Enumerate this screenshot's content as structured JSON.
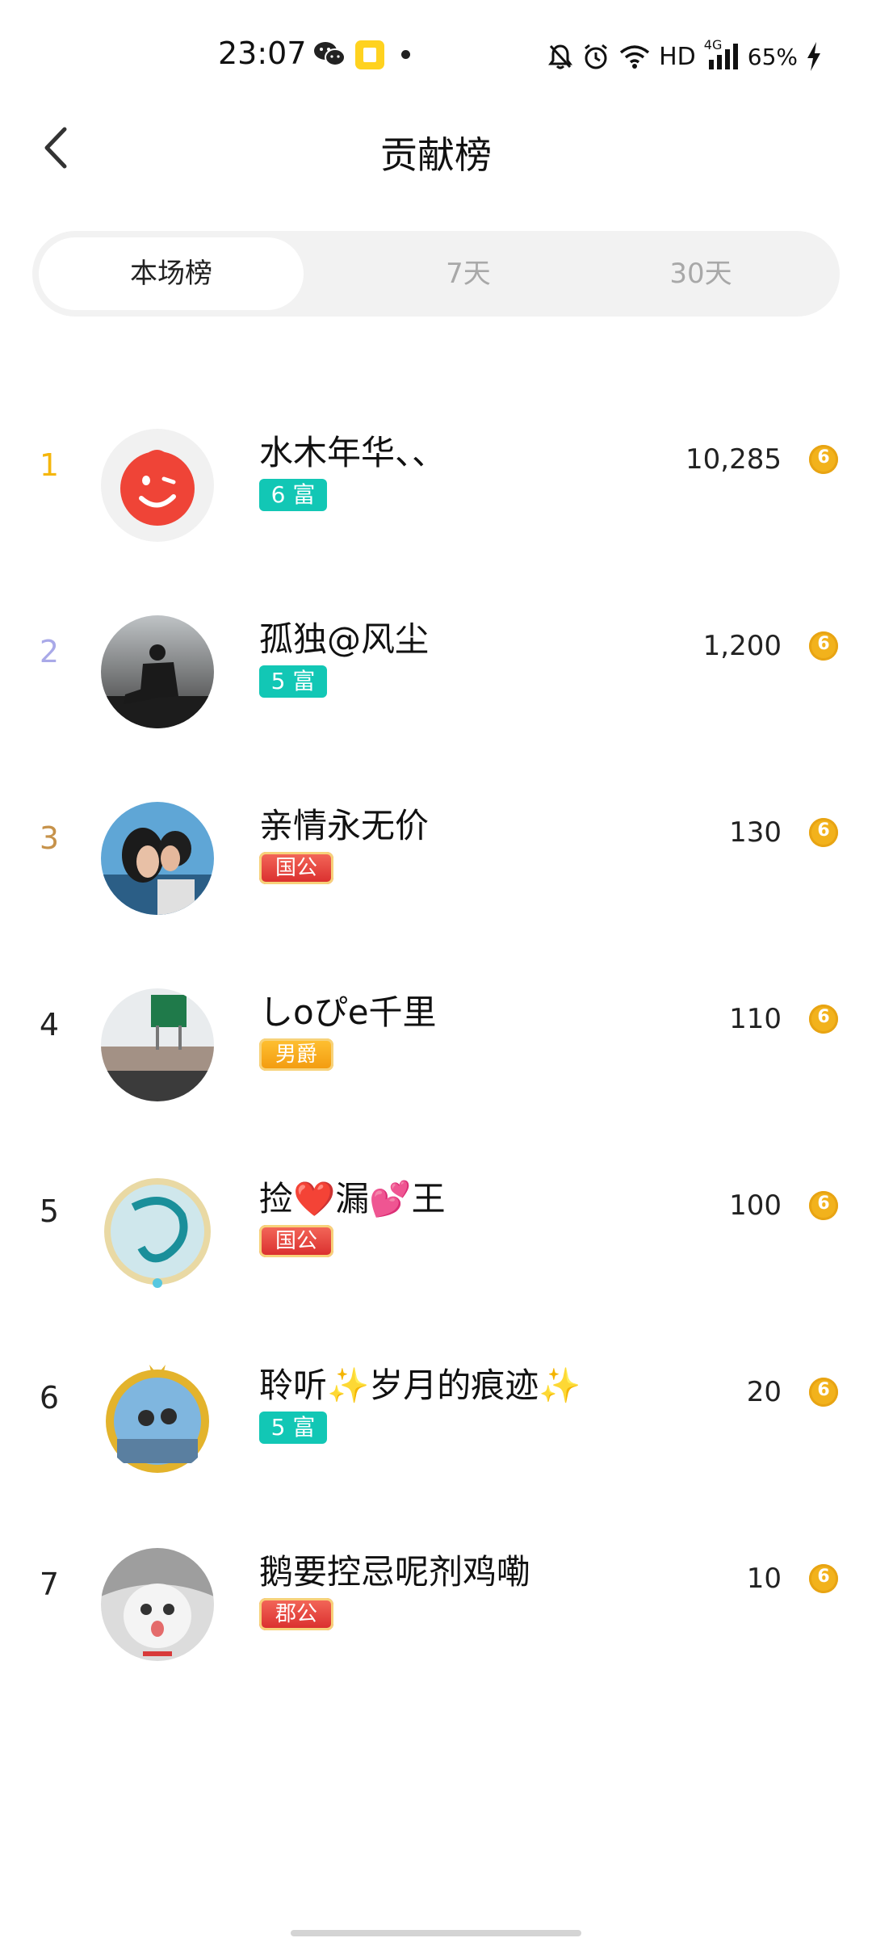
{
  "status_bar": {
    "time": "23:07",
    "network": "HD",
    "cell": "4G",
    "battery": "65%"
  },
  "header": {
    "title": "贡献榜"
  },
  "tabs": [
    {
      "label": "本场榜",
      "active": true
    },
    {
      "label": "7天",
      "active": false
    },
    {
      "label": "30天",
      "active": false
    }
  ],
  "colors": {
    "rank1": "#f5b60c",
    "rank2": "#a9a9e8",
    "rank3": "#c6924a",
    "rank_other": "#222222",
    "badge_rich": "#12c7b5",
    "badge_noble": "#e5403f",
    "coin": "#f2b21c"
  },
  "list": [
    {
      "rank": "1",
      "name": "水木年华、、",
      "badge": "6 富",
      "badge_type": "rich",
      "amount": "10,285"
    },
    {
      "rank": "2",
      "name": "孤独@风尘",
      "badge": "5 富",
      "badge_type": "rich",
      "amount": "1,200"
    },
    {
      "rank": "3",
      "name": "亲情永无价",
      "badge": "国公",
      "badge_type": "noble-red",
      "amount": "130"
    },
    {
      "rank": "4",
      "name": "しoぴe千里",
      "badge": "男爵",
      "badge_type": "noble-orange",
      "amount": "110"
    },
    {
      "rank": "5",
      "name": "捡❤️漏💕王",
      "badge": "国公",
      "badge_type": "noble-red",
      "amount": "100"
    },
    {
      "rank": "6",
      "name": "聆听✨岁月的痕迹✨",
      "badge": "5 富",
      "badge_type": "rich",
      "amount": "20"
    },
    {
      "rank": "7",
      "name": "鹅要控忌呢剂鸡嘞",
      "badge": "郡公",
      "badge_type": "noble-red",
      "amount": "10"
    }
  ]
}
